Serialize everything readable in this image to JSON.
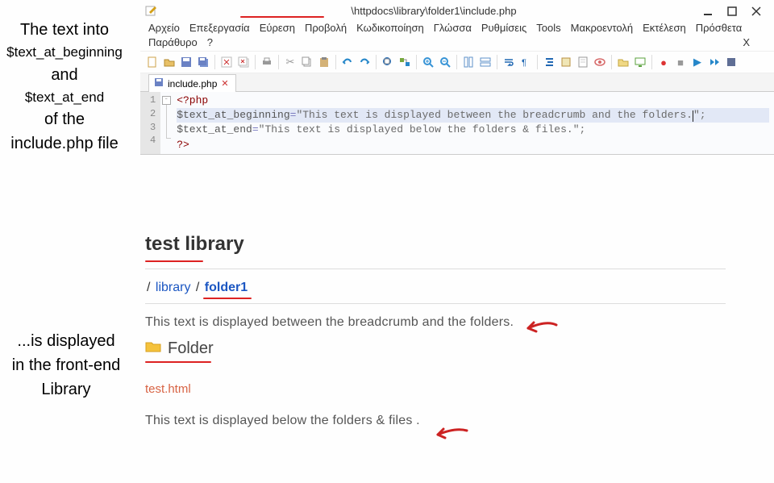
{
  "annotations": {
    "top_l1": "The text into",
    "top_l2": "$text_at_beginning",
    "top_l3": "and",
    "top_l4": "$text_at_end",
    "top_l5": "of the",
    "top_l6": "include.php file",
    "bot_l1": "...is displayed",
    "bot_l2": "in the front-end",
    "bot_l3": "Library"
  },
  "editor": {
    "title_path": "\\httpdocs\\library\\folder1\\include.php",
    "menu": [
      "Αρχείο",
      "Επεξεργασία",
      "Εύρεση",
      "Προβολή",
      "Κωδικοποίηση",
      "Γλώσσα",
      "Ρυθμίσεις",
      "Tools",
      "Μακροεντολή",
      "Εκτέλεση",
      "Πρόσθετα"
    ],
    "menu2_left": [
      "Παράθυρο",
      "?"
    ],
    "menu2_right": "X",
    "tab_name": "include.php",
    "line_numbers": [
      "1",
      "2",
      "3",
      "4"
    ],
    "code": {
      "open_tag": "<?php",
      "var1": "$text_at_beginning",
      "eq": "=",
      "str1": "\"This text is displayed between the breadcrumb and the folders.",
      "str1b": "\"",
      "semi": ";",
      "var2": "$text_at_end",
      "str2": "\"This text is displayed below the folders & files.\"",
      "close_tag": "?>"
    }
  },
  "frontend": {
    "title": "test library",
    "crumb_sep": " / ",
    "crumb_lib": "library",
    "crumb_folder": "folder1",
    "text_begin": "This text is displayed between the breadcrumb and the folders.",
    "folder_label": "Folder",
    "file_name": "test.html",
    "text_end": "This text is displayed below the folders  & files ."
  }
}
